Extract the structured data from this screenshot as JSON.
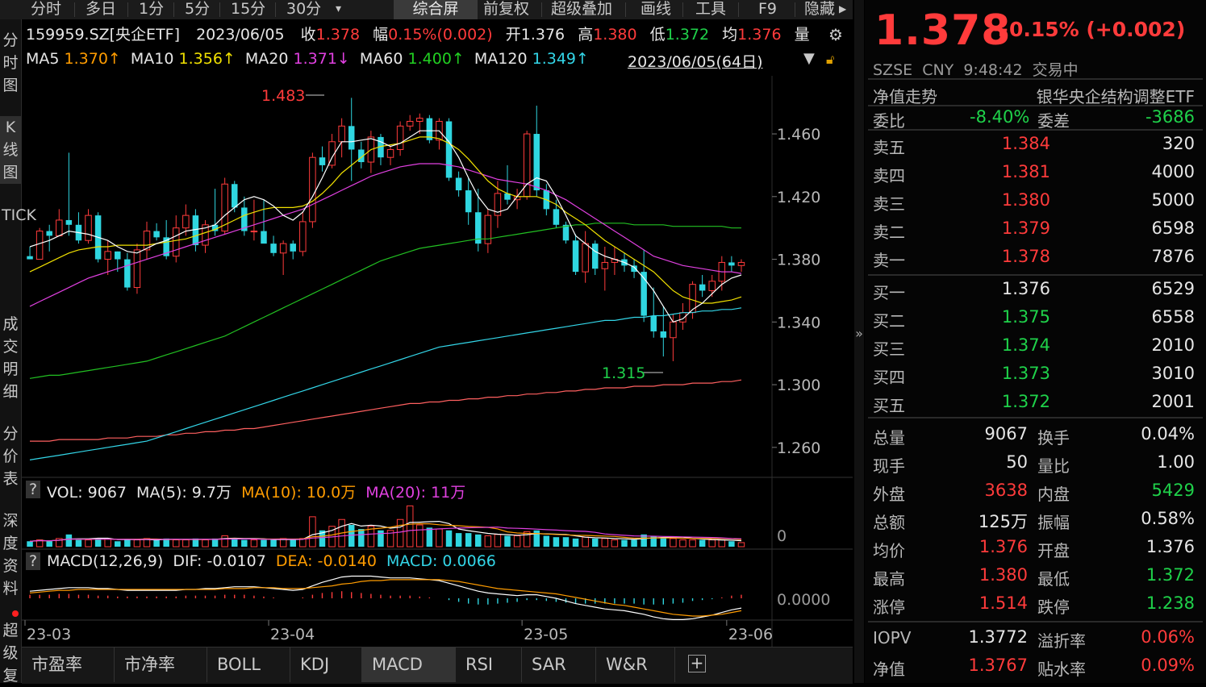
{
  "toolbar": {
    "items": [
      "分时",
      "多日",
      "1分",
      "5分",
      "15分",
      "30分",
      "▾",
      "综合屏",
      "前复权",
      "超级叠加",
      "画线",
      "工具",
      "F9",
      "隐藏"
    ],
    "selected": "综合屏"
  },
  "left_nav": [
    "分时图",
    "K线图",
    "TICK",
    "成交明细",
    "分价表",
    "深度资料",
    "超级复"
  ],
  "info_line": {
    "code": "159959.SZ[央企ETF]",
    "date": "2023/06/05",
    "close_label": "收",
    "close": "1.378",
    "range_label": "幅",
    "range": "0.15%(0.002)",
    "open_label": "开",
    "open": "1.376",
    "high_label": "高",
    "high": "1.380",
    "low_label": "低",
    "low": "1.372",
    "avg_label": "均",
    "avg": "1.376",
    "vol_label": "量"
  },
  "ma_line": {
    "ma5": "MA5",
    "ma5_val": "1.370↑",
    "ma10": "MA10",
    "ma10_val": "1.356↑",
    "ma20": "MA20",
    "ma20_val": "1.371↓",
    "ma60": "MA60",
    "ma60_val": "1.400↑",
    "ma120": "MA120",
    "ma120_val": "1.349↑",
    "period": "2023/06/05(64日)"
  },
  "annotations": {
    "high_mark": "1.483",
    "low_mark": "1.315"
  },
  "vol_line": {
    "q": "?",
    "vol": "VOL: 9067",
    "ma5": "MA(5): 9.7万",
    "ma10": "MA(10): 10.0万",
    "ma20": "MA(20): 11万",
    "axis_zero": "0"
  },
  "macd_line": {
    "q": "?",
    "title": "MACD(12,26,9)",
    "dif": "DIF: -0.0107",
    "dea": "DEA: -0.0140",
    "macd": "MACD: 0.0066",
    "axis_zero": "0.0000"
  },
  "bottom_tabs": [
    "市盈率",
    "市净率",
    "BOLL",
    "KDJ",
    "MACD",
    "RSI",
    "SAR",
    "W&R"
  ],
  "bottom_tab_selected": "MACD",
  "quote": {
    "price": "1.378",
    "change": "+0.15% (+0.002)",
    "exchange": "SZSE",
    "currency": "CNY",
    "time": "9:48:42",
    "status": "交易中",
    "nav_trend": "净值走势",
    "fund_name": "银华央企结构调整ETF",
    "weibi_label": "委比",
    "weibi": "-8.40%",
    "weicha_label": "委差",
    "weicha": "-3686"
  },
  "asks": [
    {
      "label": "卖五",
      "price": "1.384",
      "vol": "320"
    },
    {
      "label": "卖四",
      "price": "1.381",
      "vol": "4000"
    },
    {
      "label": "卖三",
      "price": "1.380",
      "vol": "5000"
    },
    {
      "label": "卖二",
      "price": "1.379",
      "vol": "6598"
    },
    {
      "label": "卖一",
      "price": "1.378",
      "vol": "7876"
    }
  ],
  "bids": [
    {
      "label": "买一",
      "price": "1.376",
      "vol": "6529"
    },
    {
      "label": "买二",
      "price": "1.375",
      "vol": "6558"
    },
    {
      "label": "买三",
      "price": "1.374",
      "vol": "2010"
    },
    {
      "label": "买四",
      "price": "1.373",
      "vol": "3010"
    },
    {
      "label": "买五",
      "price": "1.372",
      "vol": "2001"
    }
  ],
  "stats": [
    {
      "l1": "总量",
      "v1": "9067",
      "c1": "white",
      "l2": "换手",
      "v2": "0.04%",
      "c2": "white"
    },
    {
      "l1": "现手",
      "v1": "50",
      "c1": "white",
      "l2": "量比",
      "v2": "1.00",
      "c2": "white"
    },
    {
      "l1": "外盘",
      "v1": "3638",
      "c1": "red",
      "l2": "内盘",
      "v2": "5429",
      "c2": "green"
    },
    {
      "l1": "总额",
      "v1": "125万",
      "c1": "white",
      "l2": "振幅",
      "v2": "0.58%",
      "c2": "white"
    },
    {
      "l1": "均价",
      "v1": "1.376",
      "c1": "red",
      "l2": "开盘",
      "v2": "1.376",
      "c2": "white"
    },
    {
      "l1": "最高",
      "v1": "1.380",
      "c1": "red",
      "l2": "最低",
      "v2": "1.372",
      "c2": "green"
    },
    {
      "l1": "涨停",
      "v1": "1.514",
      "c1": "red",
      "l2": "跌停",
      "v2": "1.238",
      "c2": "green"
    }
  ],
  "iopv": [
    {
      "l1": "IOPV",
      "v1": "1.3772",
      "c1": "white",
      "l2": "溢折率",
      "v2": "0.06%",
      "c2": "red"
    },
    {
      "l1": "净值",
      "v1": "1.3767",
      "c1": "red",
      "l2": "贴水率",
      "v2": "0.09%",
      "c2": "red"
    }
  ],
  "colors": {
    "up": "#ff3b3b",
    "down": "#1fd14a",
    "candle_down": "#2fd6e0",
    "ma5": "#ffffff",
    "ma10": "#f0e000",
    "ma20": "#e040e0",
    "ma60": "#22c022",
    "ma120": "#33d6e8",
    "ma250": "#ff6060"
  },
  "chart_data": {
    "type": "candlestick",
    "y_ticks": [
      "1.460",
      "1.420",
      "1.380",
      "1.340",
      "1.300",
      "1.260"
    ],
    "y_tick_values": [
      1.46,
      1.42,
      1.38,
      1.34,
      1.3,
      1.26
    ],
    "x_labels": [
      "23-03",
      "23-04",
      "23-05",
      "23-06"
    ],
    "ylim": [
      1.245,
      1.495
    ],
    "candles": [
      [
        1.382,
        1.388,
        1.38,
        1.38
      ],
      [
        1.38,
        1.4,
        1.395,
        1.398
      ],
      [
        1.398,
        1.402,
        1.385,
        1.395
      ],
      [
        1.395,
        1.412,
        1.395,
        1.405
      ],
      [
        1.405,
        1.448,
        1.395,
        1.402
      ],
      [
        1.402,
        1.41,
        1.39,
        1.392
      ],
      [
        1.392,
        1.412,
        1.39,
        1.408
      ],
      [
        1.408,
        1.41,
        1.378,
        1.38
      ],
      [
        1.38,
        1.392,
        1.37,
        1.385
      ],
      [
        1.385,
        1.385,
        1.372,
        1.38
      ],
      [
        1.38,
        1.384,
        1.36,
        1.362
      ],
      [
        1.362,
        1.39,
        1.358,
        1.386
      ],
      [
        1.386,
        1.404,
        1.38,
        1.398
      ],
      [
        1.398,
        1.403,
        1.392,
        1.394
      ],
      [
        1.394,
        1.405,
        1.38,
        1.382
      ],
      [
        1.382,
        1.408,
        1.378,
        1.4
      ],
      [
        1.4,
        1.415,
        1.395,
        1.408
      ],
      [
        1.408,
        1.412,
        1.385,
        1.389
      ],
      [
        1.389,
        1.405,
        1.384,
        1.402
      ],
      [
        1.402,
        1.425,
        1.395,
        1.398
      ],
      [
        1.398,
        1.432,
        1.396,
        1.428
      ],
      [
        1.428,
        1.43,
        1.41,
        1.413
      ],
      [
        1.413,
        1.42,
        1.395,
        1.398
      ],
      [
        1.398,
        1.418,
        1.392,
        1.398
      ],
      [
        1.398,
        1.418,
        1.392,
        1.39
      ],
      [
        1.39,
        1.395,
        1.382,
        1.384
      ],
      [
        1.384,
        1.392,
        1.37,
        1.39
      ],
      [
        1.39,
        1.392,
        1.38,
        1.385
      ],
      [
        1.385,
        1.41,
        1.382,
        1.404
      ],
      [
        1.404,
        1.448,
        1.4,
        1.445
      ],
      [
        1.445,
        1.452,
        1.436,
        1.44
      ],
      [
        1.44,
        1.46,
        1.438,
        1.455
      ],
      [
        1.455,
        1.47,
        1.445,
        1.465
      ],
      [
        1.465,
        1.483,
        1.43,
        1.45
      ],
      [
        1.45,
        1.455,
        1.438,
        1.442
      ],
      [
        1.442,
        1.462,
        1.435,
        1.458
      ],
      [
        1.458,
        1.46,
        1.44,
        1.445
      ],
      [
        1.445,
        1.452,
        1.44,
        1.45
      ],
      [
        1.45,
        1.468,
        1.446,
        1.465
      ],
      [
        1.465,
        1.472,
        1.462,
        1.468
      ],
      [
        1.468,
        1.473,
        1.46,
        1.47
      ],
      [
        1.47,
        1.472,
        1.454,
        1.456
      ],
      [
        1.456,
        1.47,
        1.45,
        1.468
      ],
      [
        1.468,
        1.47,
        1.43,
        1.432
      ],
      [
        1.432,
        1.436,
        1.42,
        1.424
      ],
      [
        1.424,
        1.432,
        1.402,
        1.41
      ],
      [
        1.41,
        1.425,
        1.385,
        1.39
      ],
      [
        1.39,
        1.412,
        1.384,
        1.408
      ],
      [
        1.408,
        1.43,
        1.4,
        1.422
      ],
      [
        1.422,
        1.44,
        1.415,
        1.418
      ],
      [
        1.418,
        1.425,
        1.412,
        1.42
      ],
      [
        1.42,
        1.462,
        1.418,
        1.46
      ],
      [
        1.46,
        1.478,
        1.42,
        1.424
      ],
      [
        1.424,
        1.428,
        1.408,
        1.412
      ],
      [
        1.412,
        1.418,
        1.4,
        1.402
      ],
      [
        1.402,
        1.404,
        1.39,
        1.392
      ],
      [
        1.392,
        1.396,
        1.37,
        1.372
      ],
      [
        1.372,
        1.398,
        1.365,
        1.39
      ],
      [
        1.39,
        1.392,
        1.37,
        1.374
      ],
      [
        1.374,
        1.388,
        1.36,
        1.378
      ],
      [
        1.378,
        1.388,
        1.37,
        1.38
      ],
      [
        1.38,
        1.384,
        1.372,
        1.376
      ],
      [
        1.376,
        1.38,
        1.368,
        1.372
      ],
      [
        1.372,
        1.386,
        1.34,
        1.344
      ],
      [
        1.344,
        1.362,
        1.33,
        1.334
      ],
      [
        1.334,
        1.35,
        1.318,
        1.33
      ],
      [
        1.33,
        1.345,
        1.315,
        1.34
      ],
      [
        1.34,
        1.352,
        1.335,
        1.346
      ],
      [
        1.346,
        1.366,
        1.342,
        1.364
      ],
      [
        1.364,
        1.37,
        1.356,
        1.36
      ],
      [
        1.36,
        1.37,
        1.356,
        1.366
      ],
      [
        1.366,
        1.382,
        1.36,
        1.378
      ],
      [
        1.378,
        1.382,
        1.372,
        1.376
      ],
      [
        1.376,
        1.38,
        1.372,
        1.378
      ]
    ],
    "ma5": [
      1.388,
      1.39,
      1.392,
      1.395,
      1.398,
      1.397,
      1.396,
      1.394,
      1.392,
      1.388,
      1.385,
      1.384,
      1.387,
      1.39,
      1.392,
      1.395,
      1.398,
      1.399,
      1.4,
      1.402,
      1.408,
      1.413,
      1.418,
      1.42,
      1.418,
      1.414,
      1.408,
      1.405,
      1.41,
      1.42,
      1.432,
      1.445,
      1.455,
      1.455,
      1.456,
      1.457,
      1.455,
      1.452,
      1.454,
      1.458,
      1.462,
      1.462,
      1.462,
      1.455,
      1.445,
      1.432,
      1.42,
      1.412,
      1.41,
      1.412,
      1.42,
      1.428,
      1.432,
      1.43,
      1.42,
      1.408,
      1.395,
      1.39,
      1.385,
      1.382,
      1.38,
      1.378,
      1.375,
      1.368,
      1.36,
      1.35,
      1.34,
      1.342,
      1.348,
      1.352,
      1.358,
      1.364,
      1.368,
      1.37
    ],
    "ma10": [
      1.372,
      1.375,
      1.378,
      1.381,
      1.384,
      1.386,
      1.387,
      1.388,
      1.388,
      1.389,
      1.389,
      1.389,
      1.389,
      1.39,
      1.391,
      1.392,
      1.393,
      1.395,
      1.397,
      1.399,
      1.402,
      1.405,
      1.408,
      1.41,
      1.412,
      1.413,
      1.413,
      1.413,
      1.414,
      1.417,
      1.422,
      1.428,
      1.435,
      1.44,
      1.445,
      1.45,
      1.452,
      1.453,
      1.454,
      1.456,
      1.458,
      1.458,
      1.457,
      1.454,
      1.45,
      1.444,
      1.437,
      1.43,
      1.425,
      1.422,
      1.42,
      1.42,
      1.42,
      1.418,
      1.415,
      1.41,
      1.406,
      1.402,
      1.397,
      1.392,
      1.388,
      1.384,
      1.38,
      1.376,
      1.372,
      1.366,
      1.36,
      1.356,
      1.354,
      1.352,
      1.352,
      1.353,
      1.354,
      1.356
    ],
    "ma20": [
      1.35,
      1.353,
      1.356,
      1.359,
      1.362,
      1.365,
      1.368,
      1.37,
      1.372,
      1.374,
      1.376,
      1.378,
      1.38,
      1.382,
      1.384,
      1.386,
      1.388,
      1.39,
      1.392,
      1.394,
      1.396,
      1.398,
      1.4,
      1.402,
      1.404,
      1.406,
      1.408,
      1.41,
      1.412,
      1.415,
      1.418,
      1.421,
      1.424,
      1.427,
      1.43,
      1.433,
      1.435,
      1.437,
      1.439,
      1.44,
      1.441,
      1.441,
      1.441,
      1.44,
      1.439,
      1.437,
      1.435,
      1.433,
      1.431,
      1.43,
      1.429,
      1.428,
      1.426,
      1.424,
      1.421,
      1.418,
      1.414,
      1.41,
      1.406,
      1.402,
      1.398,
      1.394,
      1.39,
      1.386,
      1.382,
      1.38,
      1.378,
      1.376,
      1.375,
      1.374,
      1.373,
      1.372,
      1.372,
      1.371
    ],
    "ma60": [
      1.304,
      1.305,
      1.306,
      1.306,
      1.307,
      1.308,
      1.309,
      1.31,
      1.311,
      1.312,
      1.313,
      1.314,
      1.315,
      1.317,
      1.319,
      1.321,
      1.323,
      1.325,
      1.327,
      1.329,
      1.331,
      1.334,
      1.337,
      1.34,
      1.343,
      1.346,
      1.349,
      1.352,
      1.355,
      1.358,
      1.361,
      1.364,
      1.367,
      1.37,
      1.373,
      1.376,
      1.379,
      1.381,
      1.383,
      1.385,
      1.387,
      1.388,
      1.389,
      1.39,
      1.391,
      1.392,
      1.393,
      1.393,
      1.394,
      1.395,
      1.396,
      1.397,
      1.398,
      1.399,
      1.4,
      1.401,
      1.402,
      1.402,
      1.403,
      1.403,
      1.403,
      1.403,
      1.402,
      1.402,
      1.402,
      1.402,
      1.401,
      1.401,
      1.401,
      1.401,
      1.401,
      1.401,
      1.4,
      1.4
    ],
    "ma120": [
      1.252,
      1.253,
      1.254,
      1.255,
      1.256,
      1.257,
      1.258,
      1.259,
      1.26,
      1.261,
      1.262,
      1.263,
      1.264,
      1.266,
      1.268,
      1.27,
      1.272,
      1.274,
      1.276,
      1.278,
      1.28,
      1.282,
      1.284,
      1.286,
      1.288,
      1.29,
      1.292,
      1.294,
      1.296,
      1.298,
      1.3,
      1.302,
      1.304,
      1.306,
      1.308,
      1.31,
      1.312,
      1.314,
      1.316,
      1.318,
      1.32,
      1.322,
      1.324,
      1.325,
      1.326,
      1.327,
      1.328,
      1.329,
      1.33,
      1.331,
      1.332,
      1.333,
      1.334,
      1.335,
      1.336,
      1.337,
      1.338,
      1.339,
      1.34,
      1.341,
      1.341,
      1.342,
      1.343,
      1.343,
      1.344,
      1.344,
      1.345,
      1.346,
      1.346,
      1.347,
      1.347,
      1.348,
      1.348,
      1.349
    ],
    "ma250": [
      1.264,
      1.264,
      1.264,
      1.265,
      1.265,
      1.265,
      1.265,
      1.265,
      1.266,
      1.266,
      1.266,
      1.267,
      1.267,
      1.267,
      1.268,
      1.268,
      1.269,
      1.269,
      1.27,
      1.27,
      1.271,
      1.271,
      1.272,
      1.272,
      1.273,
      1.274,
      1.275,
      1.276,
      1.277,
      1.278,
      1.279,
      1.28,
      1.281,
      1.282,
      1.283,
      1.284,
      1.285,
      1.286,
      1.287,
      1.288,
      1.288,
      1.289,
      1.289,
      1.29,
      1.29,
      1.291,
      1.291,
      1.292,
      1.292,
      1.293,
      1.293,
      1.294,
      1.294,
      1.295,
      1.295,
      1.296,
      1.296,
      1.297,
      1.297,
      1.298,
      1.298,
      1.298,
      1.299,
      1.299,
      1.299,
      1.3,
      1.3,
      1.3,
      1.301,
      1.301,
      1.301,
      1.302,
      1.302,
      1.303
    ],
    "volume": [
      0.4,
      0.5,
      0.4,
      0.6,
      0.9,
      0.5,
      0.5,
      0.6,
      0.6,
      0.4,
      0.5,
      0.5,
      0.6,
      0.5,
      0.6,
      0.5,
      0.5,
      0.6,
      0.5,
      0.6,
      0.8,
      0.6,
      0.5,
      0.5,
      0.5,
      0.5,
      0.6,
      0.5,
      0.6,
      2.2,
      1.2,
      1.5,
      2.0,
      1.6,
      1.3,
      1.5,
      1.2,
      1.2,
      2.0,
      3.0,
      1.6,
      1.4,
      1.3,
      1.2,
      1.0,
      1.0,
      0.9,
      0.8,
      0.9,
      0.8,
      0.8,
      1.1,
      1.2,
      0.8,
      0.7,
      0.7,
      0.6,
      0.7,
      0.6,
      0.6,
      0.5,
      0.5,
      0.5,
      0.9,
      0.8,
      0.7,
      0.6,
      0.5,
      0.5,
      0.5,
      0.5,
      0.5,
      0.4,
      0.3
    ],
    "macd_hist": [
      0.004,
      0.004,
      0.004,
      0.005,
      0.005,
      0.004,
      0.004,
      0.003,
      0.003,
      0.002,
      0.002,
      0.002,
      0.002,
      0.002,
      0.002,
      0.002,
      0.003,
      0.003,
      0.003,
      0.003,
      0.004,
      0.004,
      0.004,
      0.003,
      0.002,
      0.001,
      0.0,
      0.0,
      0.001,
      0.004,
      0.006,
      0.007,
      0.008,
      0.007,
      0.006,
      0.005,
      0.004,
      0.003,
      0.003,
      0.003,
      0.002,
      0.001,
      0.0,
      -0.002,
      -0.004,
      -0.006,
      -0.007,
      -0.007,
      -0.006,
      -0.005,
      -0.004,
      -0.002,
      -0.002,
      -0.003,
      -0.004,
      -0.005,
      -0.006,
      -0.006,
      -0.006,
      -0.006,
      -0.006,
      -0.006,
      -0.006,
      -0.007,
      -0.007,
      -0.007,
      -0.006,
      -0.005,
      -0.003,
      -0.002,
      -0.001,
      0.001,
      0.003,
      0.004
    ],
    "dif": [
      0.008,
      0.009,
      0.01,
      0.011,
      0.012,
      0.012,
      0.012,
      0.011,
      0.011,
      0.01,
      0.009,
      0.009,
      0.009,
      0.009,
      0.009,
      0.009,
      0.01,
      0.01,
      0.011,
      0.011,
      0.012,
      0.013,
      0.013,
      0.013,
      0.012,
      0.011,
      0.01,
      0.009,
      0.01,
      0.014,
      0.018,
      0.021,
      0.024,
      0.025,
      0.025,
      0.025,
      0.024,
      0.023,
      0.023,
      0.023,
      0.022,
      0.021,
      0.02,
      0.017,
      0.014,
      0.011,
      0.008,
      0.006,
      0.005,
      0.004,
      0.003,
      0.004,
      0.004,
      0.002,
      0.0,
      -0.003,
      -0.006,
      -0.008,
      -0.01,
      -0.012,
      -0.013,
      -0.014,
      -0.016,
      -0.018,
      -0.021,
      -0.023,
      -0.024,
      -0.024,
      -0.023,
      -0.021,
      -0.019,
      -0.016,
      -0.013,
      -0.011
    ],
    "dea": [
      0.006,
      0.007,
      0.008,
      0.009,
      0.009,
      0.01,
      0.01,
      0.01,
      0.01,
      0.01,
      0.01,
      0.01,
      0.01,
      0.01,
      0.01,
      0.01,
      0.01,
      0.01,
      0.01,
      0.01,
      0.011,
      0.011,
      0.011,
      0.012,
      0.012,
      0.012,
      0.011,
      0.011,
      0.011,
      0.012,
      0.013,
      0.014,
      0.016,
      0.017,
      0.019,
      0.02,
      0.02,
      0.021,
      0.021,
      0.021,
      0.021,
      0.021,
      0.021,
      0.02,
      0.019,
      0.017,
      0.015,
      0.013,
      0.011,
      0.01,
      0.009,
      0.008,
      0.007,
      0.006,
      0.005,
      0.003,
      0.001,
      -0.001,
      -0.003,
      -0.005,
      -0.007,
      -0.008,
      -0.01,
      -0.012,
      -0.014,
      -0.016,
      -0.018,
      -0.019,
      -0.02,
      -0.02,
      -0.019,
      -0.018,
      -0.016,
      -0.014
    ]
  }
}
